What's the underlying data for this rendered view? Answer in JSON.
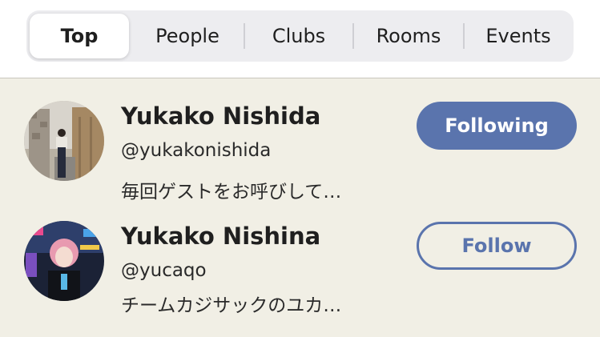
{
  "tabs": [
    {
      "label": "Top",
      "active": true
    },
    {
      "label": "People",
      "active": false
    },
    {
      "label": "Clubs",
      "active": false
    },
    {
      "label": "Rooms",
      "active": false
    },
    {
      "label": "Events",
      "active": false
    }
  ],
  "users": [
    {
      "name": "Yukako Nishida",
      "handle": "@yukakonishida",
      "bio": "毎回ゲストをお呼びして…",
      "button_label": "Following",
      "button_state": "following"
    },
    {
      "name": "Yukako Nishina",
      "handle": "@yucaqo",
      "bio": "チームカジサックのユカ…",
      "button_label": "Follow",
      "button_state": "follow"
    }
  ],
  "colors": {
    "accent": "#5a74ad",
    "list_background": "#f1efe5",
    "segmented_background": "#ededf0"
  }
}
